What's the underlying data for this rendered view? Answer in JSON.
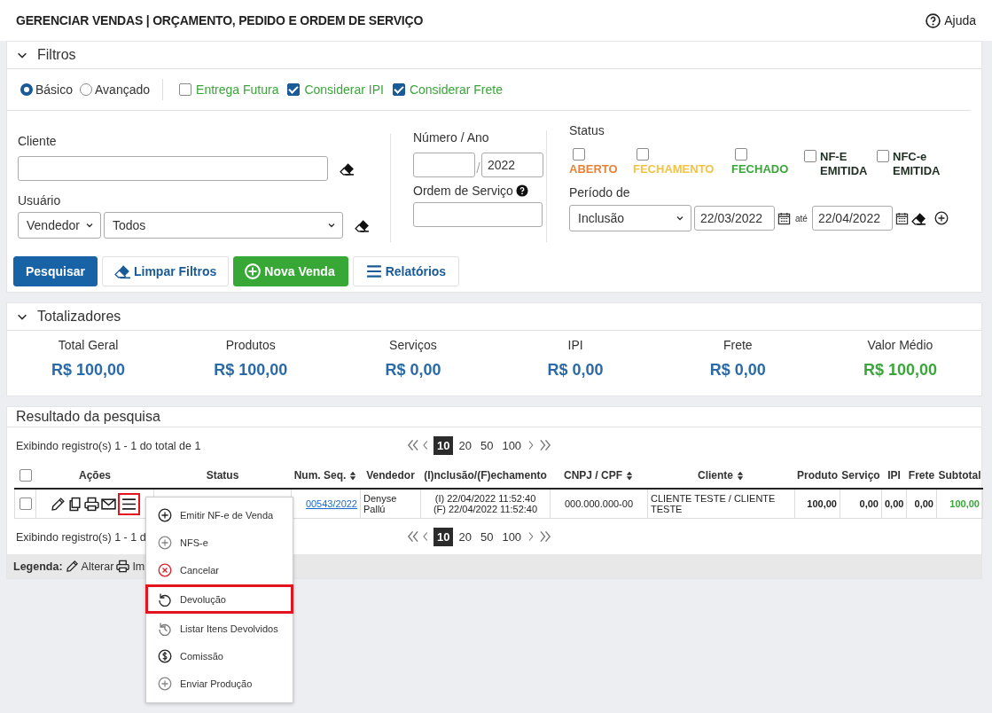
{
  "header": {
    "title": "GERENCIAR VENDAS | ORÇAMENTO, PEDIDO E ORDEM DE SERVIÇO",
    "help": "Ajuda"
  },
  "filters": {
    "title": "Filtros",
    "expanded": true,
    "modes": [
      {
        "label": "Básico",
        "selected": true
      },
      {
        "label": "Avançado",
        "selected": false
      }
    ],
    "toggles": [
      {
        "label": "Entrega Futura",
        "checked": false
      },
      {
        "label": "Considerar IPI",
        "checked": true
      },
      {
        "label": "Considerar Frete",
        "checked": true
      }
    ],
    "cliente_label": "Cliente",
    "usuario_label": "Usuário",
    "usuario_type": "Vendedor",
    "usuario_value": "Todos",
    "numero_label": "Número / Ano",
    "ano": "2022",
    "ordem_label": "Ordem de Serviço",
    "status_label": "Status",
    "status_options": [
      {
        "label": "ABERTO",
        "checked": false,
        "color": "#e8823a"
      },
      {
        "label": "FECHAMENTO",
        "checked": false,
        "color": "#f5c242"
      },
      {
        "label": "FECHADO",
        "checked": false,
        "color": "#3aa63a"
      },
      {
        "label": "NF-E EMITIDA",
        "checked": false,
        "color": "#1e2e20"
      },
      {
        "label": "NFC-e EMITIDA",
        "checked": false,
        "color": "#1e2e20"
      }
    ],
    "periodo_label": "Período de",
    "periodo_value": "Inclusão",
    "date_from": "22/03/2022",
    "ate": "até",
    "date_to": "22/04/2022",
    "buttons": [
      {
        "label": "Pesquisar",
        "kind": "primary"
      },
      {
        "label": "Limpar Filtros",
        "kind": "eraser"
      },
      {
        "label": "Nova Venda",
        "kind": "success"
      },
      {
        "label": "Relatórios",
        "kind": "list"
      }
    ]
  },
  "totals": {
    "title": "Totalizadores",
    "expanded": true,
    "items": [
      {
        "label": "Total Geral",
        "value": "R$ 100,00",
        "color": "#2a6aa8"
      },
      {
        "label": "Produtos",
        "value": "R$ 100,00",
        "color": "#2a6aa8"
      },
      {
        "label": "Serviços",
        "value": "R$ 0,00",
        "color": "#2a6aa8"
      },
      {
        "label": "IPI",
        "value": "R$ 0,00",
        "color": "#2a6aa8"
      },
      {
        "label": "Frete",
        "value": "R$ 0,00",
        "color": "#2a6aa8"
      },
      {
        "label": "Valor Médio",
        "value": "R$ 100,00",
        "color": "#3aa63a"
      }
    ]
  },
  "results": {
    "title": "Resultado da pesquisa",
    "top_bar": {
      "info": "Exibindo registro(s) 1 - 1 do total de 1",
      "page_sizes": [
        {
          "label": "10",
          "selected": true
        },
        {
          "label": "20",
          "selected": false
        },
        {
          "label": "50",
          "selected": false
        },
        {
          "label": "100",
          "selected": false
        }
      ]
    },
    "all_checked": false,
    "columns": [
      {
        "label": "Ações",
        "sortable": false
      },
      {
        "label": "Status",
        "sortable": false
      },
      {
        "label": "Num. Seq.",
        "sortable": true
      },
      {
        "label": "Vendedor",
        "sortable": false
      },
      {
        "label": "(I)nclusão/(F)echamento",
        "sortable": false
      },
      {
        "label": "CNPJ / CPF",
        "sortable": true
      },
      {
        "label": "Cliente",
        "sortable": true
      },
      {
        "label": "Produto",
        "sortable": false
      },
      {
        "label": "Serviço",
        "sortable": false
      },
      {
        "label": "IPI",
        "sortable": false
      },
      {
        "label": "Frete",
        "sortable": false
      },
      {
        "label": "Subtotal",
        "sortable": false
      }
    ],
    "rows": [
      {
        "checked": false,
        "actions": [
          {
            "kind": "edit",
            "highlighted": false
          },
          {
            "kind": "copy",
            "highlighted": false
          },
          {
            "kind": "print",
            "highlighted": false
          },
          {
            "kind": "mail",
            "highlighted": false
          },
          {
            "kind": "menu",
            "highlighted": true
          }
        ],
        "num_seq": "00543/2022",
        "vendedor": "Denyse Pallú",
        "inclusao": "(I) 22/04/2022 11:52:40",
        "fechamento": "(F) 22/04/2022 11:52:40",
        "cnpj": "000.000.000-00",
        "cliente": "CLIENTE TESTE / CLIENTE TESTE",
        "produto": "100,00",
        "servico": "0,00",
        "ipi": "0,00",
        "frete": "0,00",
        "subtotal": "100,00"
      }
    ],
    "bottom_bar": {
      "info": "Exibindo registro(s) 1 - 1 d",
      "page_sizes": [
        {
          "label": "10",
          "selected": true
        },
        {
          "label": "20",
          "selected": false
        },
        {
          "label": "50",
          "selected": false
        },
        {
          "label": "100",
          "selected": false
        }
      ]
    },
    "legend": {
      "label": "Legenda:",
      "items": [
        {
          "kind": "edit",
          "label": "Alterar"
        },
        {
          "kind": "print",
          "label": "Im"
        }
      ]
    }
  },
  "context_menu": {
    "items": [
      {
        "label": "Emitir NF-e de Venda",
        "kind": "plus",
        "selected": false
      },
      {
        "label": "NFS-e",
        "kind": "plus-muted",
        "selected": false
      },
      {
        "label": "Cancelar",
        "kind": "cancel",
        "selected": false
      },
      {
        "label": "Devolução",
        "kind": "undo",
        "selected": true
      },
      {
        "label": "Listar Itens Devolvidos",
        "kind": "history",
        "selected": false
      },
      {
        "label": "Comissão",
        "kind": "dollar",
        "selected": false
      },
      {
        "label": "Enviar Produção",
        "kind": "plus-muted",
        "selected": false
      }
    ]
  }
}
